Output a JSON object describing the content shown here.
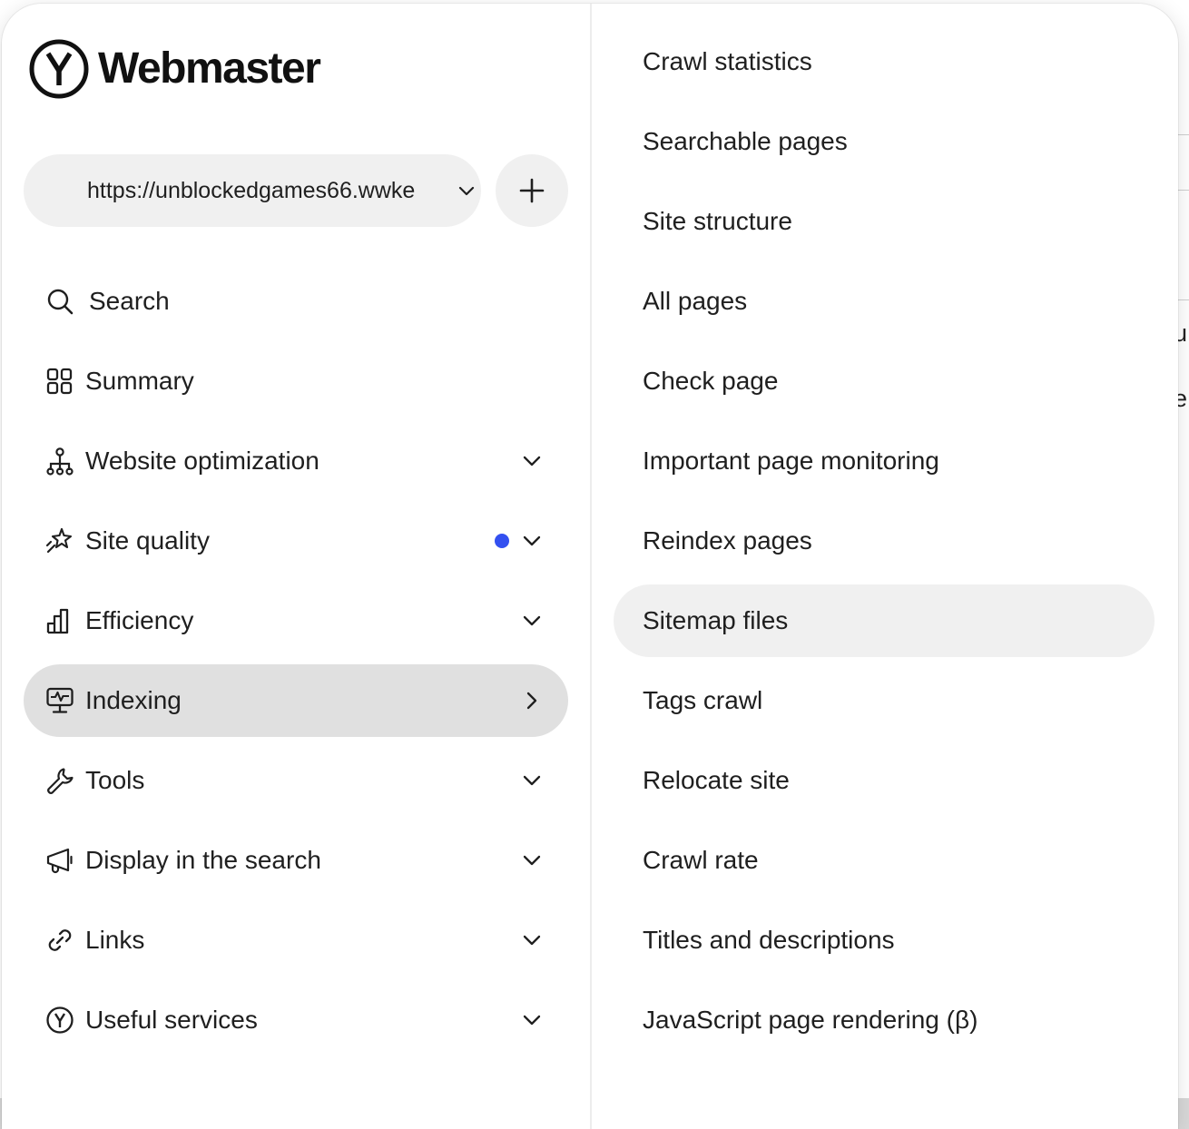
{
  "brand": {
    "name": "Webmaster",
    "logo_icon": "yandex-y-logo"
  },
  "site_selector": {
    "value": "https://unblockedgames66.wwke",
    "chevron_icon": "chevron-down-icon",
    "add_icon": "plus-icon"
  },
  "nav": {
    "items": [
      {
        "label": "Search",
        "icon": "search-icon"
      },
      {
        "label": "Summary",
        "icon": "grid-icon"
      },
      {
        "label": "Website optimization",
        "icon": "hierarchy-icon",
        "chevron": "down"
      },
      {
        "label": "Site quality",
        "icon": "sparkle-icon",
        "chevron": "down",
        "badge_dot": true
      },
      {
        "label": "Efficiency",
        "icon": "bar-chart-icon",
        "chevron": "down"
      },
      {
        "label": "Indexing",
        "icon": "monitor-pulse-icon",
        "chevron": "right",
        "active": true
      },
      {
        "label": "Tools",
        "icon": "wrench-icon",
        "chevron": "down"
      },
      {
        "label": "Display in the search",
        "icon": "megaphone-icon",
        "chevron": "down"
      },
      {
        "label": "Links",
        "icon": "link-icon",
        "chevron": "down"
      },
      {
        "label": "Useful services",
        "icon": "yandex-circle-icon",
        "chevron": "down"
      }
    ]
  },
  "submenu": {
    "items": [
      {
        "label": "Crawl statistics"
      },
      {
        "label": "Searchable pages"
      },
      {
        "label": "Site structure"
      },
      {
        "label": "All pages"
      },
      {
        "label": "Check page"
      },
      {
        "label": "Important page monitoring"
      },
      {
        "label": "Reindex pages"
      },
      {
        "label": "Sitemap files",
        "active": true
      },
      {
        "label": "Tags crawl"
      },
      {
        "label": "Relocate site"
      },
      {
        "label": "Crawl rate"
      },
      {
        "label": "Titles and descriptions"
      },
      {
        "label": "JavaScript page rendering (β)"
      }
    ]
  },
  "background": {
    "fragments": [
      "u",
      "e"
    ]
  },
  "colors": {
    "active_nav_bg": "#e0e0e0",
    "active_sub_bg": "#f0f0f0",
    "badge_dot": "#3350f0",
    "text": "#1f1f1f"
  }
}
